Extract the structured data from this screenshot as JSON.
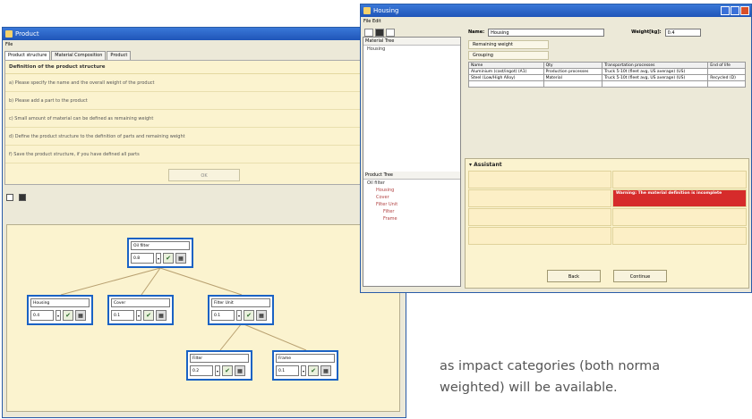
{
  "product_window": {
    "title": "Product",
    "menu": "File",
    "tabs": [
      "Product structure",
      "Material Composition",
      "Product"
    ],
    "section_heading": "Definition of the product structure",
    "steps": [
      "a) Please specify the name and the overall weight of the product",
      "b) Please add a part to the product",
      "c) Small amount of material can be defined as remaining weight",
      "d) Define the product structure to the definition of parts and remaining weight",
      "f) Save the product structure, if you have defined all parts"
    ],
    "ok_label": "OK",
    "nodes": [
      {
        "label": "Oil filter",
        "value": "0.8"
      },
      {
        "label": "Housing",
        "value": "0.4"
      },
      {
        "label": "Cover",
        "value": "0.1"
      },
      {
        "label": "Filter Unit",
        "value": "0.1"
      },
      {
        "label": "Filter",
        "value": "0.2"
      },
      {
        "label": "Frame",
        "value": "0.1"
      }
    ]
  },
  "housing_window": {
    "title": "Housing",
    "menu": "File  Edit",
    "name_label": "Name:",
    "name_value": "Housing",
    "weight_label": "Weight[kg]:",
    "weight_value": "0.4",
    "tree_head": "Material Tree",
    "tree_root": "Housing",
    "product_tree_head": "Product Tree",
    "product_tree": [
      {
        "label": "Oil filter",
        "level": 0
      },
      {
        "label": "Housing",
        "level": 1
      },
      {
        "label": "Cover",
        "level": 1
      },
      {
        "label": "Filter Unit",
        "level": 1
      },
      {
        "label": "Filter",
        "level": 2
      },
      {
        "label": "Frame",
        "level": 2
      }
    ],
    "radio1": "Remaining weight",
    "radio2": "Grouping",
    "table_headers": [
      "Name",
      "Qty",
      "Transportation processes",
      "End of life"
    ],
    "table_rows": [
      [
        "Aluminium (cast/ingot) (A1)",
        "Production processes",
        "Truck 5-10t (fleet avg, US average) (US)",
        ""
      ],
      [
        "Steel (Low/High Alloy)",
        "Material",
        "Truck 5-10t (fleet avg, US average) (US)",
        "Recycled (D)"
      ]
    ],
    "assistant_title": "Assistant",
    "warning_text": "Warning: The material definition is incomplete",
    "back_label": "Back",
    "continue_label": "Continue"
  },
  "caption": {
    "line1": "as impact categories (both norma",
    "line2": "weighted) will be available."
  }
}
